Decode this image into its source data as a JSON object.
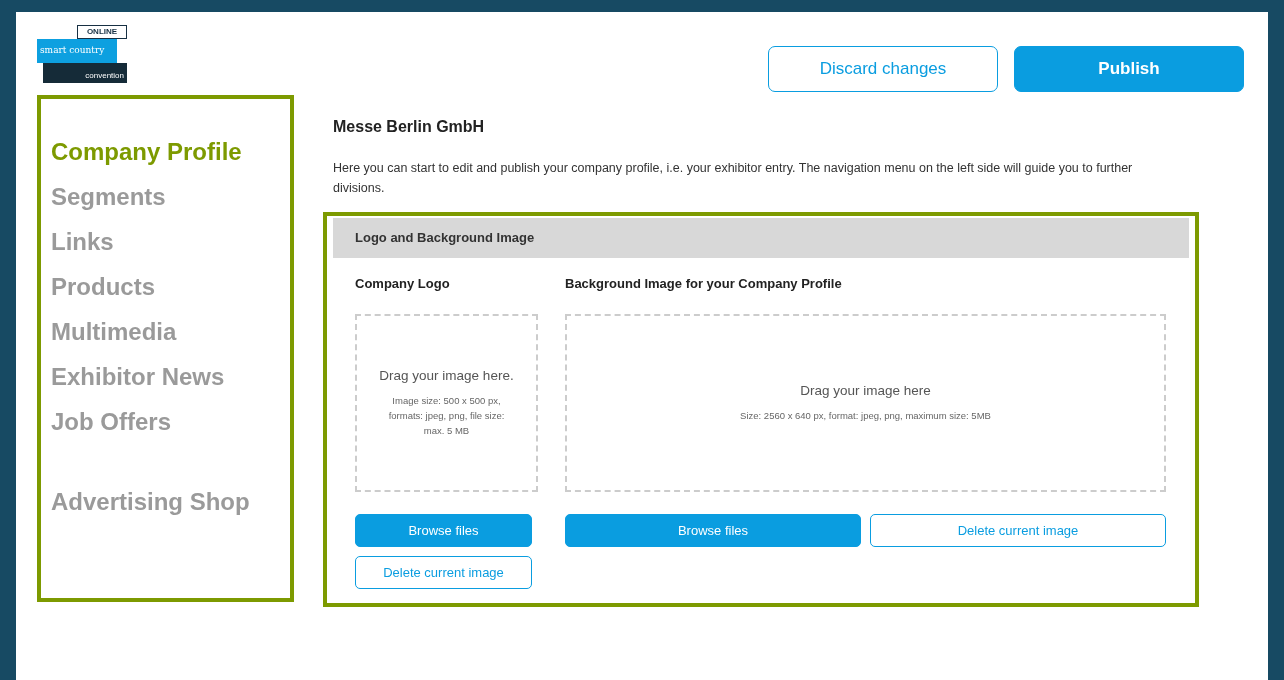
{
  "logo": {
    "badge": "ONLINE",
    "name": "smart country",
    "tagline": "convention"
  },
  "header_buttons": [
    {
      "label": "Discard changes",
      "kind": "outline"
    },
    {
      "label": "Publish",
      "kind": "primary"
    }
  ],
  "sidebar": {
    "groups": [
      {
        "items": [
          {
            "label": "Company Profile",
            "selected": true
          },
          {
            "label": "Segments",
            "selected": false
          },
          {
            "label": "Links",
            "selected": false
          },
          {
            "label": "Products",
            "selected": false
          },
          {
            "label": "Multimedia",
            "selected": false
          },
          {
            "label": "Exhibitor News",
            "selected": false
          },
          {
            "label": "Job Offers",
            "selected": false
          }
        ]
      },
      {
        "items": [
          {
            "label": "Advertising Shop",
            "selected": false
          }
        ]
      }
    ]
  },
  "company": {
    "name": "Messe Berlin GmbH",
    "intro": "Here you can start to edit and publish your company profile, i.e. your exhibitor entry. The navigation menu on the left side will guide you to further divisions."
  },
  "section": {
    "title": "Logo and Background Image",
    "uploads": [
      {
        "kind": "logo",
        "title": "Company Logo",
        "drop_text": "Drag your image here.",
        "hint": "Image size: 500 x 500 px, formats: jpeg, png, file size: max. 5 MB",
        "buttons": [
          {
            "label": "Browse files",
            "kind": "primary"
          },
          {
            "label": "Delete current image",
            "kind": "outline"
          }
        ]
      },
      {
        "kind": "background",
        "title": "Background Image for your Company Profile",
        "drop_text": "Drag your image here",
        "hint": "Size: 2560 x 640 px, format: jpeg, png, maximum size: 5MB",
        "buttons": [
          {
            "label": "Browse files",
            "kind": "primary"
          },
          {
            "label": "Delete current image",
            "kind": "outline"
          }
        ]
      }
    ]
  }
}
